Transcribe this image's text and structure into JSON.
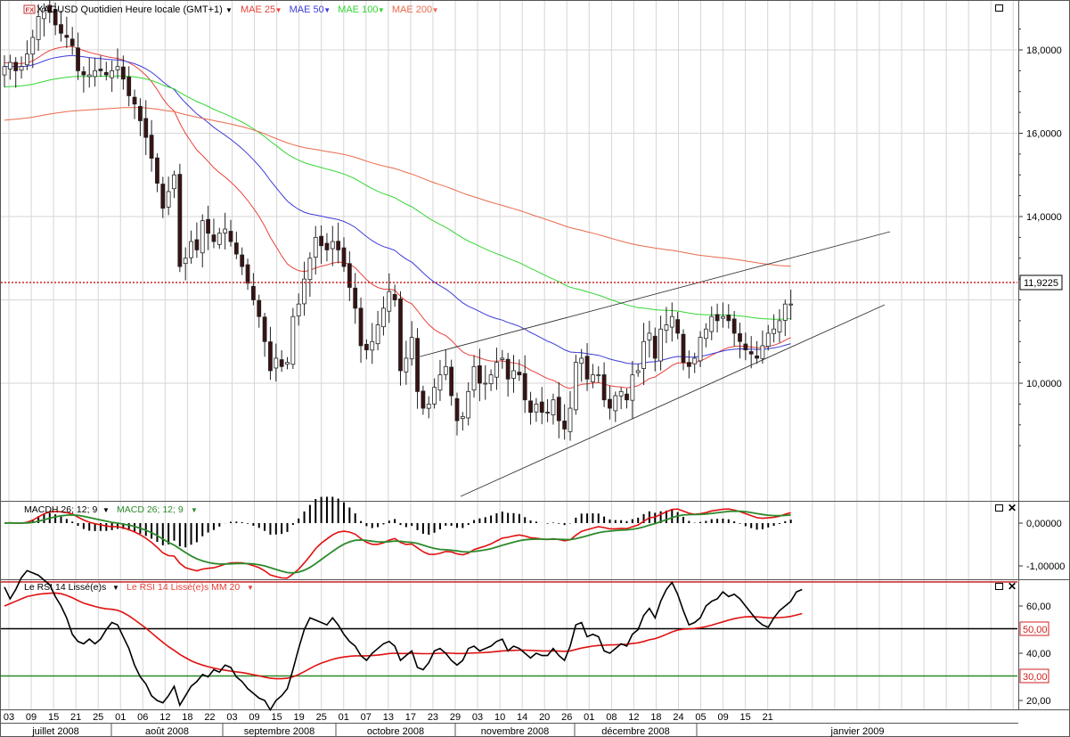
{
  "chart_data": [
    {
      "type": "candlestick",
      "title": "XAGUSD Quotidien Heure locale (GMT+1)",
      "legend": [
        {
          "name": "MAE 25",
          "color": "#e8413a"
        },
        {
          "name": "MAE 50",
          "color": "#3c3cd8"
        },
        {
          "name": "MAE 100",
          "color": "#33d633"
        },
        {
          "name": "MAE 200",
          "color": "#e86a4a"
        }
      ],
      "ylim": [
        8.2,
        19.0
      ],
      "yticks": [
        "18,0000",
        "16,0000",
        "14,0000",
        "10,0000"
      ],
      "last_price": "11,9225",
      "grid": true,
      "series": {
        "close": [
          17.6,
          17.7,
          17.5,
          17.6,
          17.9,
          18.3,
          18.8,
          19.0,
          18.9,
          18.6,
          18.4,
          18.3,
          18.1,
          17.5,
          17.4,
          17.4,
          17.5,
          17.5,
          17.4,
          17.5,
          17.6,
          17.3,
          16.9,
          16.7,
          16.3,
          15.9,
          15.4,
          14.8,
          14.2,
          14.6,
          15.0,
          12.8,
          13.0,
          13.4,
          13.2,
          13.9,
          13.6,
          13.4,
          13.6,
          13.7,
          13.4,
          13.1,
          12.8,
          12.4,
          12.0,
          11.6,
          11.0,
          10.3,
          10.6,
          10.4,
          10.5,
          11.6,
          11.9,
          12.5,
          13.0,
          13.5,
          13.3,
          13.2,
          13.4,
          13.2,
          12.8,
          12.3,
          11.8,
          10.9,
          10.8,
          11.0,
          11.4,
          11.8,
          12.2,
          12.0,
          10.3,
          10.6,
          11.1,
          9.8,
          9.4,
          9.5,
          9.9,
          10.2,
          10.4,
          9.7,
          9.1,
          9.2,
          9.8,
          10.4,
          10.0,
          10.0,
          10.2,
          10.5,
          10.6,
          10.1,
          10.3,
          10.2,
          9.6,
          9.3,
          9.5,
          9.3,
          9.3,
          9.6,
          9.1,
          8.9,
          9.4,
          10.5,
          10.6,
          10.1,
          10.2,
          10.2,
          9.6,
          9.4,
          9.7,
          9.8,
          9.6,
          10.2,
          10.3,
          11.0,
          11.2,
          10.6,
          11.3,
          11.4,
          11.6,
          11.2,
          10.5,
          10.4,
          10.6,
          11.1,
          11.3,
          11.6,
          11.5,
          11.6,
          11.5,
          11.2,
          11.0,
          10.8,
          10.7,
          10.6,
          10.9,
          11.2,
          11.3,
          11.5,
          11.9,
          11.9
        ]
      }
    },
    {
      "type": "line",
      "legend": [
        {
          "name": "MACDH 26; 12; 9",
          "color": "#000000"
        },
        {
          "name": "MACD 26; 12; 9",
          "color": "#2c8a2c"
        }
      ],
      "yticks": [
        "0,00000",
        "-1,00000"
      ]
    },
    {
      "type": "line",
      "legend": [
        {
          "name": "Le RSI 14 Lissé(e)s",
          "color": "#000000"
        },
        {
          "name": "Le RSI 14 Lissé(e)s MM 20",
          "color": "#e8413a"
        }
      ],
      "yticks": [
        "60,00",
        "40,00",
        "20,00"
      ],
      "levels": [
        "50,00",
        "30,00"
      ],
      "series": {
        "rsi": [
          68,
          63,
          67,
          72,
          75,
          74,
          73,
          71,
          69,
          64,
          60,
          55,
          48,
          45,
          44,
          46,
          44,
          46,
          50,
          53,
          52,
          47,
          42,
          35,
          30,
          27,
          22,
          20,
          19,
          22,
          26,
          18,
          22,
          26,
          28,
          31,
          30,
          33,
          32,
          35,
          34,
          30,
          28,
          25,
          23,
          21,
          20,
          16,
          20,
          22,
          25,
          33,
          42,
          50,
          55,
          54,
          53,
          52,
          55,
          52,
          48,
          45,
          43,
          39,
          37,
          40,
          42,
          44,
          45,
          43,
          37,
          39,
          41,
          34,
          33,
          36,
          41,
          42,
          40,
          37,
          35,
          37,
          42,
          43,
          41,
          42,
          43,
          45,
          46,
          41,
          43,
          42,
          40,
          38,
          40,
          39,
          39,
          42,
          39,
          37,
          43,
          52,
          53,
          47,
          48,
          47,
          41,
          40,
          42,
          44,
          43,
          48,
          50,
          56,
          59,
          55,
          62,
          67,
          70,
          65,
          58,
          52,
          53,
          55,
          60,
          62,
          63,
          66,
          64,
          65,
          63,
          60,
          57,
          54,
          52,
          51,
          55,
          58,
          60,
          62,
          66,
          67
        ]
      },
      "mm20": [
        60,
        61,
        62,
        63,
        64,
        64.5,
        65,
        65.2,
        65.4,
        65.5,
        65.2,
        64.5,
        63.5,
        62.3,
        61.2,
        60.5,
        59.8,
        59.2,
        58.8,
        58.6,
        58.2,
        57.2,
        55.8,
        54.2,
        52.4,
        50.6,
        48.6,
        46.6,
        44.6,
        42.8,
        41.2,
        39.5,
        38.1,
        36.8,
        35.8,
        35.0,
        34.3,
        33.7,
        33.2,
        32.8,
        32.4,
        32.1,
        31.8,
        31.4,
        30.9,
        30.4,
        29.9,
        29.4,
        29.2,
        29.2,
        29.4,
        30.0,
        31.0,
        32.2,
        33.5,
        34.8,
        35.8,
        36.6,
        37.4,
        38.0,
        38.4,
        38.7,
        38.9,
        38.9,
        38.9,
        39.0,
        39.2,
        39.5,
        39.9,
        40.0,
        39.9,
        39.9,
        40.0,
        39.9,
        39.8,
        39.8,
        39.9,
        40.0,
        40.1,
        40.0,
        39.9,
        39.9,
        40.0,
        40.1,
        40.2,
        40.3,
        40.5,
        40.7,
        41.0,
        41.1,
        41.2,
        41.3,
        41.3,
        41.2,
        41.1,
        41.0,
        41.0,
        41.0,
        40.9,
        40.8,
        41.0,
        41.6,
        42.2,
        42.6,
        43.0,
        43.3,
        43.4,
        43.5,
        43.6,
        43.7,
        43.8,
        44.1,
        44.4,
        45.0,
        45.7,
        46.2,
        47.0,
        48.0,
        49.0,
        49.8,
        50.2,
        50.3,
        50.5,
        50.8,
        51.3,
        51.9,
        52.6,
        53.3,
        54.0,
        54.6,
        55.1,
        55.4,
        55.5,
        55.4,
        55.2,
        55.0,
        55.0,
        55.1,
        55.3,
        55.6,
        56.2,
        56.8
      ]
    }
  ],
  "xaxis": {
    "days": [
      "03",
      "09",
      "15",
      "21",
      "25",
      "01",
      "06",
      "12",
      "18",
      "22",
      "03",
      "09",
      "15",
      "19",
      "25",
      "01",
      "07",
      "13",
      "17",
      "23",
      "29",
      "03",
      "10",
      "14",
      "20",
      "26",
      "01",
      "08",
      "12",
      "18",
      "24",
      "05",
      "09",
      "15",
      "21"
    ],
    "months": [
      "juillet 2008",
      "août 2008",
      "septembre 2008",
      "octobre 2008",
      "novembre 2008",
      "décembre 2008",
      "janvier 2009"
    ]
  }
}
